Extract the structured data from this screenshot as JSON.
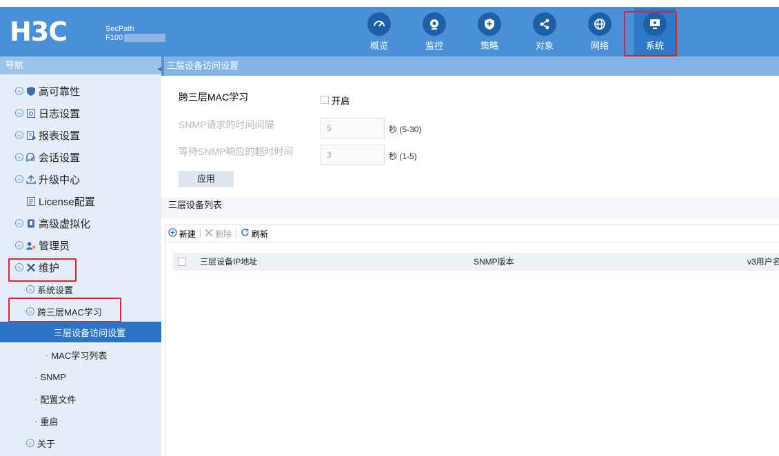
{
  "header": {
    "logo": "H3C",
    "product_line1": "SecPath",
    "product_line2": "F100",
    "nav": [
      {
        "label": "概览",
        "icon": "gauge-icon"
      },
      {
        "label": "监控",
        "icon": "camera-icon"
      },
      {
        "label": "策略",
        "icon": "shield-icon"
      },
      {
        "label": "对象",
        "icon": "share-icon"
      },
      {
        "label": "网络",
        "icon": "globe-icon"
      },
      {
        "label": "系统",
        "icon": "monitor-settings-icon",
        "active": true
      }
    ]
  },
  "sidebar": {
    "title": "导航",
    "items": [
      {
        "label": "高可靠性",
        "icon": "shield-icon"
      },
      {
        "label": "日志设置",
        "icon": "log-icon"
      },
      {
        "label": "报表设置",
        "icon": "report-icon"
      },
      {
        "label": "会话设置",
        "icon": "session-icon"
      },
      {
        "label": "升级中心",
        "icon": "upgrade-icon"
      },
      {
        "label": "License配置",
        "icon": "license-icon"
      },
      {
        "label": "高级虚拟化",
        "icon": "virtualization-icon"
      },
      {
        "label": "管理员",
        "icon": "admin-icon"
      },
      {
        "label": "维护",
        "icon": "tools-icon"
      },
      {
        "label": "系统设置"
      },
      {
        "label": "跨三层MAC学习"
      },
      {
        "label": "三层设备访问设置",
        "selected": true
      },
      {
        "label": "MAC学习列表"
      },
      {
        "label": "SNMP"
      },
      {
        "label": "配置文件"
      },
      {
        "label": "重启"
      },
      {
        "label": "关于"
      }
    ]
  },
  "content": {
    "title": "三层设备访问设置",
    "form": {
      "mac_learning_label": "跨三层MAC学习",
      "enable_label": "开启",
      "enable_checked": false,
      "snmp_interval_label": "SNMP请求的时间间隔",
      "snmp_interval_value": "5",
      "snmp_interval_unit": "秒 (5-30)",
      "snmp_timeout_label": "等待SNMP响应的超时时间",
      "snmp_timeout_value": "3",
      "snmp_timeout_unit": "秒 (1-5)",
      "apply_label": "应用"
    },
    "list_title": "三层设备列表",
    "toolbar": {
      "new_label": "新建",
      "delete_label": "删除",
      "refresh_label": "刷新"
    },
    "table": {
      "columns": [
        "三层设备IP地址",
        "SNMP版本",
        "v3用户名"
      ]
    }
  }
}
